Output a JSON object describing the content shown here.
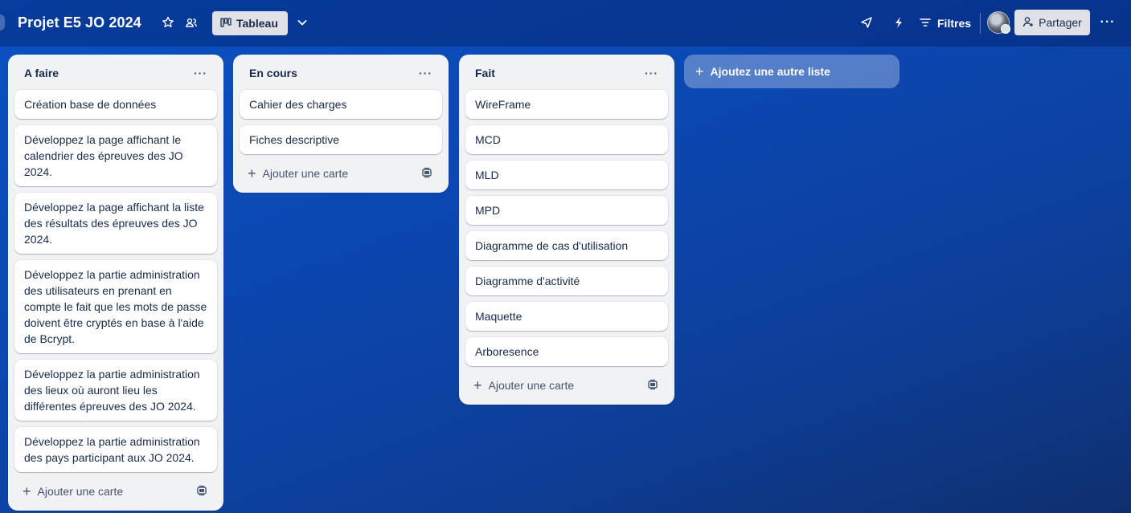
{
  "header": {
    "board_title": "Projet E5 JO 2024",
    "view_label": "Tableau",
    "filters_label": "Filtres",
    "share_label": "Partager",
    "more_label": "···",
    "icons": [
      "star-icon",
      "workspace-icon",
      "board-view-icon",
      "chevron-down-icon",
      "power-ups-icon",
      "automation-icon",
      "filter-icon",
      "avatar",
      "share-icon",
      "more-icon"
    ]
  },
  "lists": [
    {
      "title": "A faire",
      "menu": "···",
      "cards": [
        "Création base de données",
        "Développez la page affichant le calendrier des épreuves des JO 2024.",
        "Développez la page affichant la liste des résultats des épreuves des JO 2024.",
        "Développez la partie administration des utilisateurs en prenant en compte le fait que les mots de passe doivent être cryptés en base à l'aide de Bcrypt.",
        "Développez la partie administration des lieux où auront lieu les différentes épreuves des JO 2024.",
        "Développez la partie administration des pays participant aux JO 2024."
      ],
      "add_card": "Ajouter une carte"
    },
    {
      "title": "En cours",
      "menu": "···",
      "cards": [
        "Cahier des charges",
        "Fiches descriptive"
      ],
      "add_card": "Ajouter une carte"
    },
    {
      "title": "Fait",
      "menu": "···",
      "cards": [
        "WireFrame",
        "MCD",
        "MLD",
        "MPD",
        "Diagramme de cas d'utilisation",
        "Diagramme d'activité",
        "Maquette",
        "Arboresence"
      ],
      "add_card": "Ajouter une carte"
    }
  ],
  "add_list_label": "Ajoutez une autre liste",
  "colors": {
    "background": "#0b47b0",
    "list_bg": "#f1f2f4",
    "card_bg": "#ffffff",
    "text": "#172b4d"
  }
}
